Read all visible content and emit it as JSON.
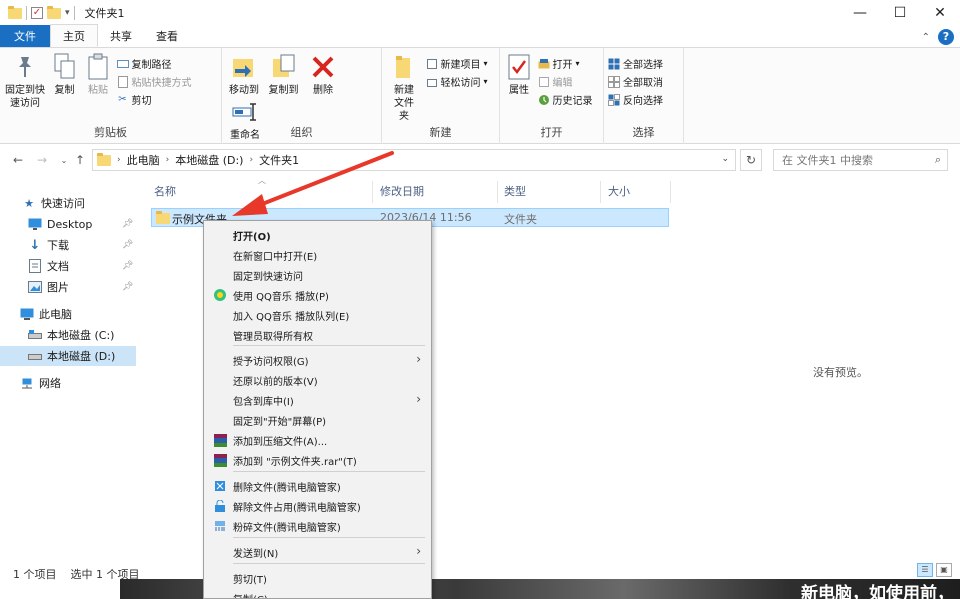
{
  "window": {
    "title": "文件夹1",
    "controls": {
      "minimize": "—",
      "maximize": "☐",
      "close": "✕"
    }
  },
  "tabs": [
    {
      "label": "文件"
    },
    {
      "label": "主页"
    },
    {
      "label": "共享"
    },
    {
      "label": "查看"
    }
  ],
  "ribbon": {
    "clipboard": {
      "label": "剪贴板",
      "pin": "固定到快速访问",
      "copy": "复制",
      "paste": "粘贴",
      "copy_path": "复制路径",
      "paste_shortcut": "粘贴快捷方式",
      "cut": "剪切"
    },
    "organize": {
      "label": "组织",
      "move_to": "移动到",
      "copy_to": "复制到",
      "delete": "删除",
      "rename": "重命名"
    },
    "new": {
      "label": "新建",
      "new_folder": "新建文件夹",
      "new_item": "新建项目",
      "easy_access": "轻松访问"
    },
    "open": {
      "label": "打开",
      "properties": "属性",
      "open": "打开",
      "edit": "编辑",
      "history": "历史记录"
    },
    "select": {
      "label": "选择",
      "select_all": "全部选择",
      "select_none": "全部取消",
      "invert": "反向选择"
    }
  },
  "address": {
    "crumbs": [
      "此电脑",
      "本地磁盘 (D:)",
      "文件夹1"
    ],
    "search_placeholder": "在 文件夹1 中搜索"
  },
  "nav": {
    "quick_access": "快速访问",
    "items": [
      {
        "label": "Desktop",
        "icon": "desktop-icon"
      },
      {
        "label": "下载",
        "icon": "download-icon"
      },
      {
        "label": "文档",
        "icon": "document-icon"
      },
      {
        "label": "图片",
        "icon": "picture-icon"
      }
    ],
    "this_pc": "此电脑",
    "drives": [
      "本地磁盘 (C:)",
      "本地磁盘 (D:)"
    ],
    "network": "网络"
  },
  "columns": [
    "名称",
    "修改日期",
    "类型",
    "大小"
  ],
  "files": [
    {
      "name": "示例文件夹",
      "date": "2023/6/14 11:56",
      "type": "文件夹",
      "size": ""
    }
  ],
  "preview": "没有预览。",
  "status": {
    "count": "1 个项目",
    "selected": "选中 1 个项目"
  },
  "overlay_text": "新电脑，如使用前，",
  "context_menu": [
    {
      "label": "打开(O)",
      "bold": true
    },
    {
      "label": "在新窗口中打开(E)"
    },
    {
      "label": "固定到快速访问"
    },
    {
      "label": "使用 QQ音乐 播放(P)",
      "icon": "qqmusic-icon"
    },
    {
      "label": "加入 QQ音乐 播放队列(E)"
    },
    {
      "label": "管理员取得所有权"
    },
    {
      "label": "授予访问权限(G)",
      "submenu": true
    },
    {
      "label": "还原以前的版本(V)"
    },
    {
      "label": "包含到库中(I)",
      "submenu": true
    },
    {
      "label": "固定到\"开始\"屏幕(P)"
    },
    {
      "label": "添加到压缩文件(A)...",
      "icon": "winrar-icon"
    },
    {
      "label": "添加到 \"示例文件夹.rar\"(T)",
      "icon": "winrar-icon"
    },
    {
      "label": "删除文件(腾讯电脑管家)",
      "icon": "tencent-delete-icon"
    },
    {
      "label": "解除文件占用(腾讯电脑管家)",
      "icon": "tencent-unlock-icon"
    },
    {
      "label": "粉碎文件(腾讯电脑管家)",
      "icon": "tencent-shred-icon"
    },
    {
      "label": "发送到(N)",
      "submenu": true
    },
    {
      "label": "剪切(T)"
    },
    {
      "label": "复制(C)"
    }
  ],
  "colors": {
    "accent": "#1a6fc2",
    "selection": "#cce8ff",
    "annotation_arrow": "#e8382a"
  }
}
